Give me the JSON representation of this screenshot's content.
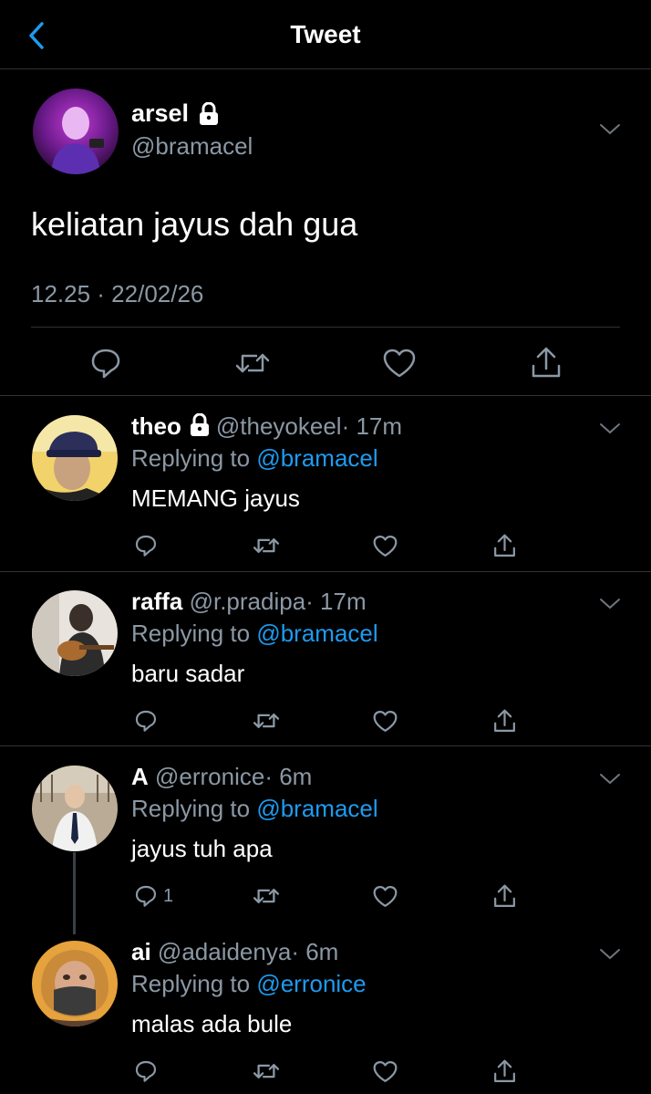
{
  "header": {
    "title": "Tweet"
  },
  "colors": {
    "background": "#000000",
    "text": "#ffffff",
    "muted": "#8b98a5",
    "accent": "#1d9bf0",
    "divider": "#2f3336"
  },
  "main_tweet": {
    "name": "arsel",
    "handle": "@bramacel",
    "text": "keliatan jayus dah gua",
    "timestamp": "12.25 · 22/02/26",
    "protected": true
  },
  "replies": [
    {
      "name": "theo",
      "protected": true,
      "handle": "@theyokeel",
      "time": "· 17m",
      "replying_label": "Replying to",
      "replying_to": "@bramacel",
      "text": "MEMANG jayus",
      "reply_count": ""
    },
    {
      "name": "raffa",
      "protected": false,
      "handle": "@r.pradipa",
      "time": "· 17m",
      "replying_label": "Replying to",
      "replying_to": "@bramacel",
      "text": "baru sadar",
      "reply_count": ""
    },
    {
      "name": "A",
      "protected": false,
      "handle": "@erronice",
      "time": "· 6m",
      "replying_label": "Replying to",
      "replying_to": "@bramacel",
      "text": "jayus tuh apa",
      "reply_count": "1"
    },
    {
      "name": "ai",
      "protected": false,
      "handle": "@adaidenya",
      "time": "· 6m",
      "replying_label": "Replying to",
      "replying_to": "@erronice",
      "text": "malas ada bule",
      "reply_count": ""
    }
  ],
  "icons": {
    "back": "chevron-left-icon",
    "more": "chevron-down-icon",
    "lock": "lock-icon",
    "reply": "reply-icon",
    "retweet": "retweet-icon",
    "like": "heart-icon",
    "share": "share-icon"
  }
}
